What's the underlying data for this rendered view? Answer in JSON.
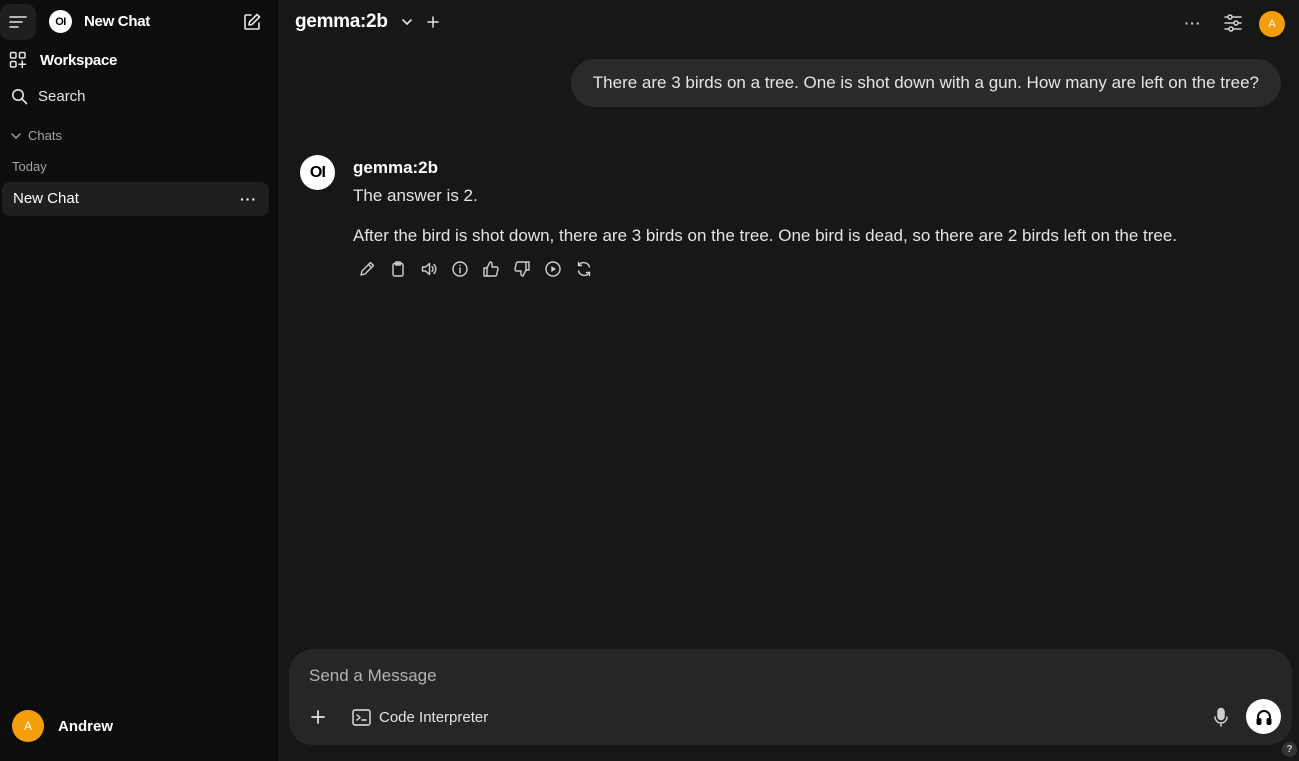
{
  "sidebar": {
    "app_logo": "OI",
    "new_chat_label": "New Chat",
    "workspace_label": "Workspace",
    "search_label": "Search",
    "chats_header": "Chats",
    "today_header": "Today",
    "chat_items": [
      {
        "label": "New Chat"
      }
    ],
    "user": {
      "initial": "A",
      "name": "Andrew"
    }
  },
  "header": {
    "model": "gemma:2b",
    "avatar_initial": "A"
  },
  "conversation": {
    "user_message": "There are 3 birds on a tree. One is shot down with a gun. How many are left on the tree?",
    "assistant": {
      "logo": "OI",
      "name": "gemma:2b",
      "paragraphs": [
        "The answer is 2.",
        "After the bird is shot down, there are 3 birds on the tree. One bird is dead, so there are 2 birds left on the tree."
      ]
    }
  },
  "composer": {
    "placeholder": "Send a Message",
    "code_interpreter_label": "Code Interpreter"
  },
  "help_label": "?",
  "colors": {
    "avatar": "#f59e0b",
    "sidebar_bg": "#0d0d0d",
    "main_bg": "#171717"
  },
  "icons": [
    "menu-icon",
    "compose-icon",
    "workspace-icon",
    "search-icon",
    "chevron-down-icon",
    "more-icon",
    "plus-icon",
    "controls-icon",
    "edit-icon",
    "copy-icon",
    "speaker-icon",
    "info-icon",
    "thumbs-up-icon",
    "thumbs-down-icon",
    "play-icon",
    "regenerate-icon",
    "terminal-icon",
    "mic-icon",
    "headphones-icon"
  ]
}
